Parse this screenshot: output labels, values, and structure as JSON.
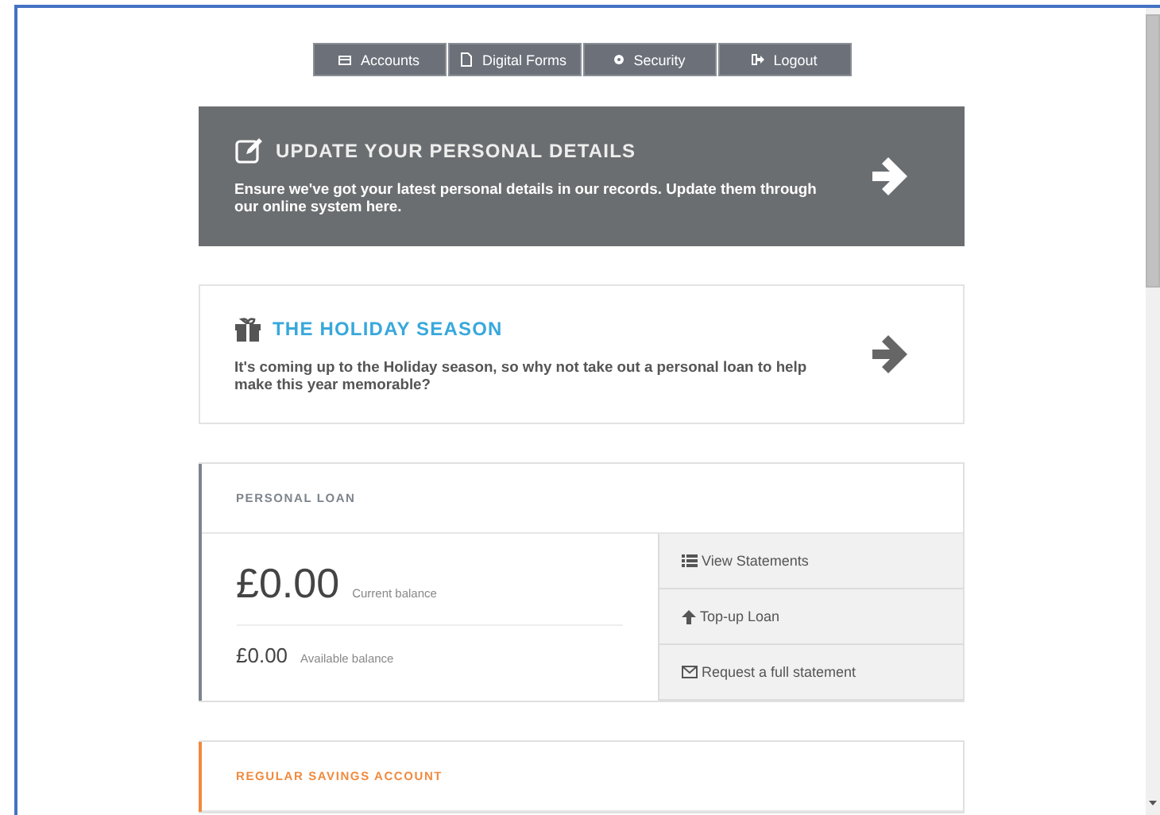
{
  "nav": [
    {
      "label": "Accounts"
    },
    {
      "label": "Digital Forms"
    },
    {
      "label": "Security"
    },
    {
      "label": "Logout"
    }
  ],
  "banners": [
    {
      "kind": "dark",
      "title": "UPDATE YOUR PERSONAL DETAILS",
      "text": "Ensure we've got your latest personal details in our records. Update them through our online system here."
    },
    {
      "kind": "light",
      "title": "THE HOLIDAY SEASON",
      "text": "It's coming up to the Holiday season, so why not take out a personal loan to help make this year memorable?"
    }
  ],
  "accounts": [
    {
      "title": "PERSONAL LOAN",
      "color": "#7d848c",
      "current_balance": "£0.00",
      "current_label": "Current balance",
      "available_balance": "£0.00",
      "available_label": "Available balance",
      "actions": [
        "View Statements",
        "Top-up Loan",
        "Request a full statement"
      ]
    },
    {
      "title": "REGULAR SAVINGS ACCOUNT",
      "color": "#f08a3e"
    }
  ]
}
